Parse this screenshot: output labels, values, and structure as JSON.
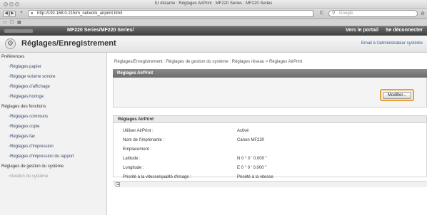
{
  "window": {
    "title": "IU distante : Réglages AirPrint : MF220 Series : MF220 Series"
  },
  "browser": {
    "back_label": "◀",
    "forward_label": "▶",
    "add_label": "+",
    "url": "http://192.168.0.215/m_network_airprint.html",
    "reload_label": "C",
    "search_placeholder": "Google",
    "bookmarks": [
      "▭",
      "☐",
      "▦"
    ]
  },
  "topbar": {
    "title": "MF220 Series/MF220 Series/",
    "portal_link": "Vers le portail",
    "logout_link": "Se déconnecter"
  },
  "pageheader": {
    "title": "Réglages/Enregistrement",
    "email_link": "Email à l'administrateur système"
  },
  "sidebar": {
    "items": [
      {
        "label": "Préférences",
        "level": "head"
      },
      {
        "label": "Réglages papier",
        "level": "sub"
      },
      {
        "label": "Réglage volume sonore",
        "level": "sub"
      },
      {
        "label": "Réglages d'affichage",
        "level": "sub"
      },
      {
        "label": "Réglages horloge",
        "level": "sub"
      },
      {
        "label": "Réglages des fonctions",
        "level": "head"
      },
      {
        "label": "Réglages communs",
        "level": "sub"
      },
      {
        "label": "Réglages copie",
        "level": "sub"
      },
      {
        "label": "Réglages fax",
        "level": "sub"
      },
      {
        "label": "Réglages d'impression",
        "level": "sub"
      },
      {
        "label": "Réglages d'impression du rapport",
        "level": "sub"
      },
      {
        "label": "Réglages de gestion du système",
        "level": "head"
      },
      {
        "label": "Gestion du système",
        "level": "sub"
      }
    ]
  },
  "main": {
    "breadcrumb": "Réglages/Enregistrement : Réglages de gestion du système : Réglages réseau > Réglages AirPrint",
    "header": "Réglages AirPrint",
    "modify_button": "Modifier...",
    "section_title": "Réglages AirPrint",
    "rows": [
      {
        "label": "Utiliser AirPrint :",
        "value": "Activé"
      },
      {
        "label": "Nom de l'imprimante :",
        "value": "Canon MF220"
      },
      {
        "label": "Emplacement :",
        "value": ""
      },
      {
        "label": "Latitude :",
        "value": "N 0 ° 0 ' 0.000 \""
      },
      {
        "label": "Longitude :",
        "value": "E 0 ° 0 ' 0.000 \""
      },
      {
        "label": "Priorité à la vitesse/qualité d'image :",
        "value": "Priorité à la vitesse"
      }
    ]
  }
}
